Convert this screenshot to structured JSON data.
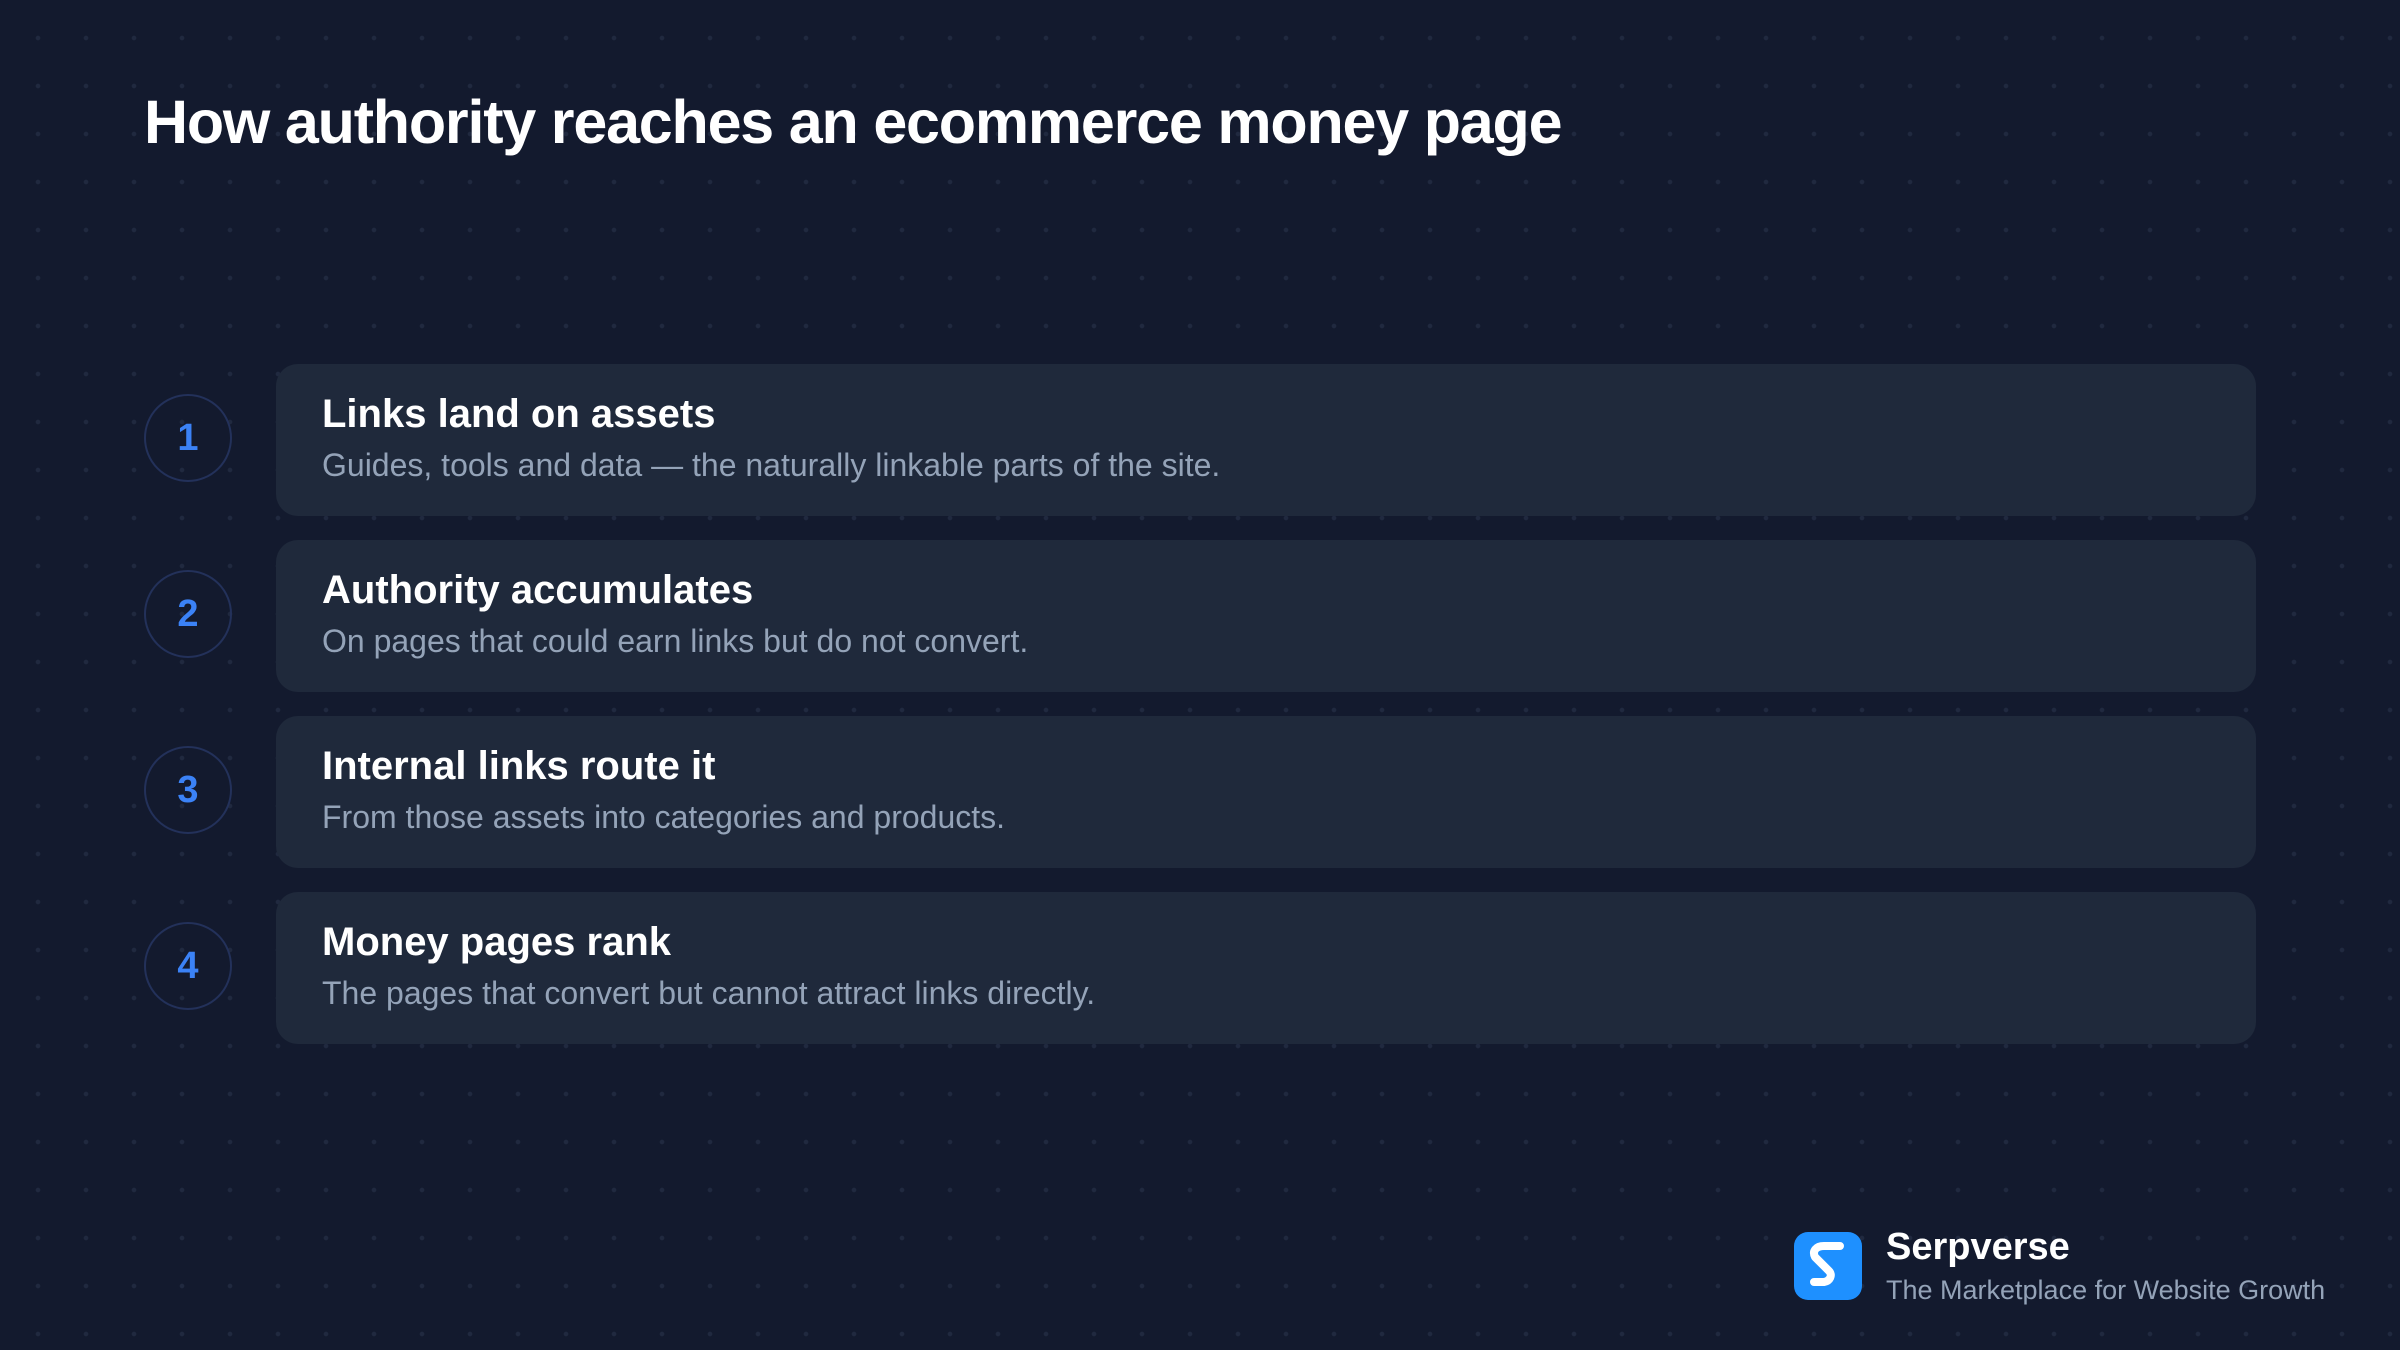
{
  "title": "How authority reaches an ecommerce money page",
  "steps": [
    {
      "number": "1",
      "title": "Links land on assets",
      "description": "Guides, tools and data — the naturally linkable parts of the site."
    },
    {
      "number": "2",
      "title": "Authority accumulates",
      "description": "On pages that could earn links but do not convert."
    },
    {
      "number": "3",
      "title": "Internal links route it",
      "description": "From those assets into categories and products."
    },
    {
      "number": "4",
      "title": "Money pages rank",
      "description": "The pages that convert but cannot attract links directly."
    }
  ],
  "brand": {
    "name": "Serpverse",
    "tagline": "The Marketplace for Website Growth",
    "logo_icon": "serpverse-s-logo-icon"
  },
  "colors": {
    "background": "#131a2e",
    "card": "#1f293b",
    "accent": "#3b82f6",
    "logo": "#1e90ff",
    "muted_text": "#94a3b8"
  }
}
